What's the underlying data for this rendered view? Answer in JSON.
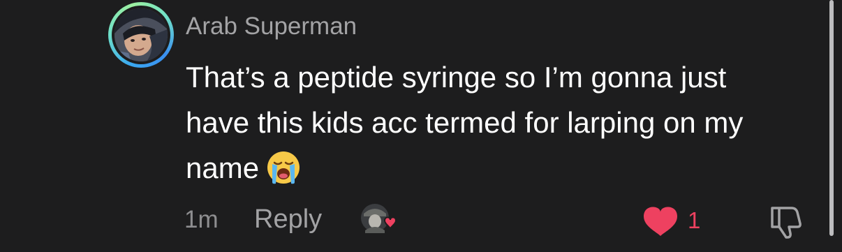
{
  "comment": {
    "username": "Arab Superman",
    "lines": [
      "That’s a peptide syringe so I’m gonna just",
      "have this kids acc termed for larping on my",
      "name"
    ],
    "emoji": "loudly-crying-face",
    "time": "1m",
    "reply_label": "Reply",
    "like_count": "1"
  },
  "colors": {
    "background": "#1d1d1e",
    "text": "#ffffff",
    "muted": "#a3a3a5",
    "like": "#ee4160"
  },
  "icons": {
    "avatar": "user-avatar",
    "liker_avatar": "liked-by-avatar",
    "like": "heart-icon",
    "dislike": "thumbs-down-icon"
  }
}
